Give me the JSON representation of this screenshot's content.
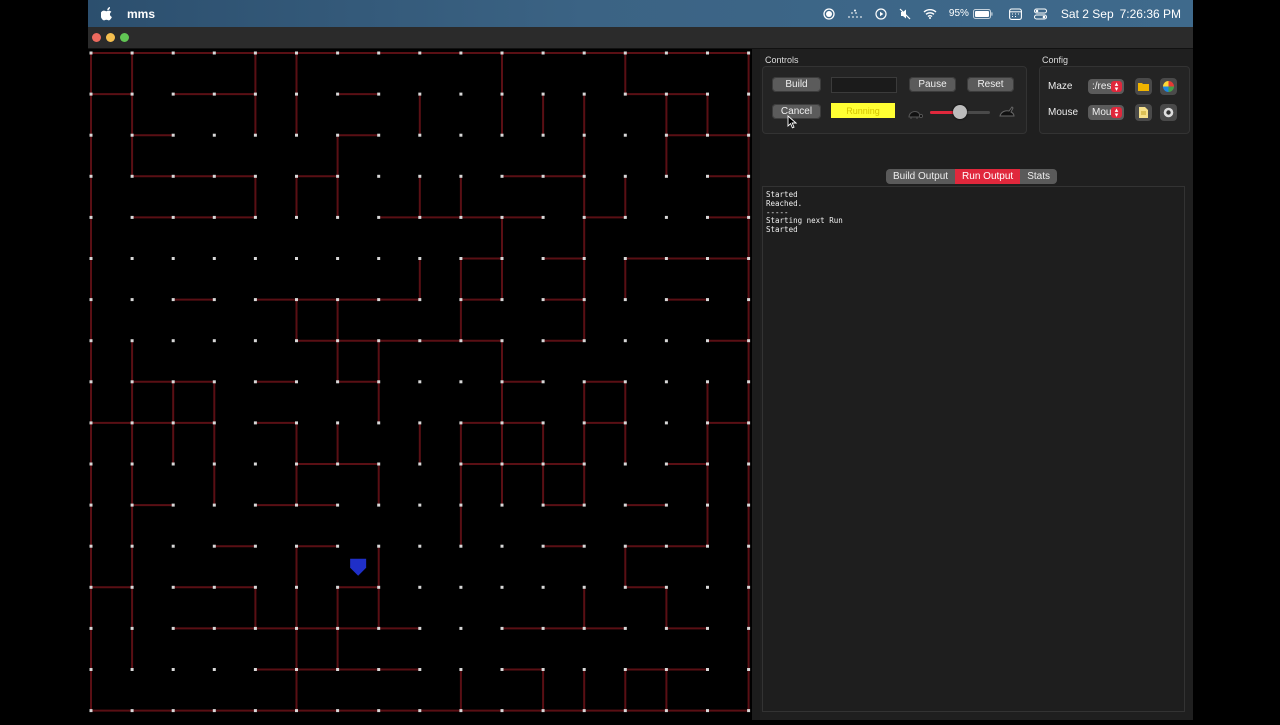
{
  "menubar": {
    "app_name": "mms",
    "battery_percent": "95%",
    "date": "Sat 2 Sep",
    "time": "7:26:36 PM",
    "icons": [
      "apple-icon",
      "record-icon",
      "dashed-status-icon",
      "play-circle-icon",
      "mute-icon",
      "wifi-icon",
      "battery-icon",
      "calendar-icon",
      "control-center-icon"
    ]
  },
  "controls": {
    "group_title": "Controls",
    "build_label": "Build",
    "pause_label": "Pause",
    "reset_label": "Reset",
    "cancel_label": "Cancel",
    "status_label": "Running",
    "status_color": "#ffff33",
    "speed_level": 0.5,
    "speed_icons": [
      "turtle-icon",
      "rabbit-icon"
    ]
  },
  "config": {
    "group_title": "Config",
    "maze_label": "Maze",
    "maze_value": ":/res",
    "mouse_label": "Mouse",
    "mouse_value": "Mou"
  },
  "tabs": [
    {
      "label": "Build Output",
      "active": false
    },
    {
      "label": "Run Output",
      "active": true
    },
    {
      "label": "Stats",
      "active": false
    }
  ],
  "output_lines": [
    "Started",
    "Reached.",
    "-----",
    "Starting next Run",
    "Started"
  ],
  "colors": {
    "accent": "#e0283c",
    "maze_wall": "#5a0f14",
    "maze_post": "#d8d8d8",
    "mouse": "#1f2fc8"
  },
  "maze": {
    "cells": 16,
    "mouse_cell": {
      "col": 6,
      "row": 12
    }
  }
}
